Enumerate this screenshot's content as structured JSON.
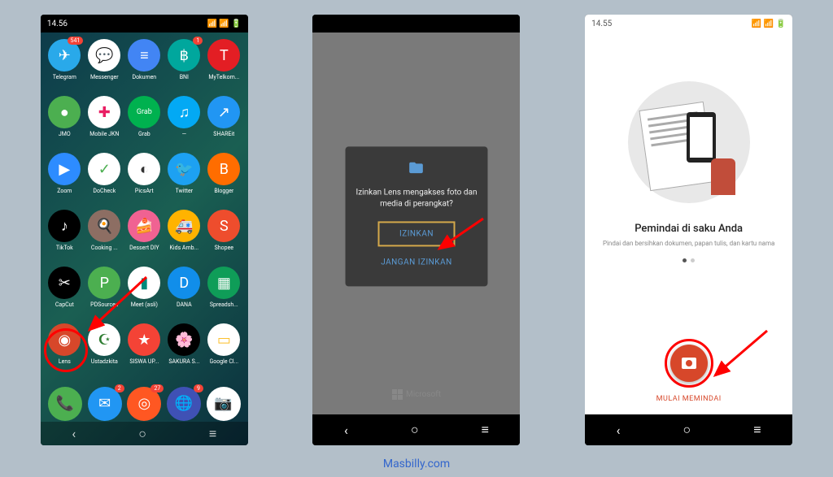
{
  "statusbar": {
    "time1": "14.56",
    "time3": "14.55",
    "icons_text": "⚙"
  },
  "phone1": {
    "apps": [
      {
        "label": "Telegram",
        "bg": "#29a9ea",
        "glyph": "✈",
        "badge": "541"
      },
      {
        "label": "Messenger",
        "bg": "#fff",
        "glyph": "💬",
        "fg": "#1e88e5"
      },
      {
        "label": "Dokumen",
        "bg": "#4285f4",
        "glyph": "≡"
      },
      {
        "label": "BNI",
        "bg": "#00a79d",
        "glyph": "฿",
        "badge": "1"
      },
      {
        "label": "MyTelkom...",
        "bg": "#e31e24",
        "glyph": "T"
      },
      {
        "label": "JMO",
        "bg": "#4caf50",
        "glyph": "●"
      },
      {
        "label": "Mobile JKN",
        "bg": "#fff",
        "glyph": "✚",
        "fg": "#e91e63"
      },
      {
        "label": "Grab",
        "bg": "#00b14f",
        "glyph": "Grab"
      },
      {
        "label": "—",
        "bg": "#03a9f4",
        "glyph": "♫"
      },
      {
        "label": "SHAREit",
        "bg": "#2196f3",
        "glyph": "↗"
      },
      {
        "label": "Zoom",
        "bg": "#2d8cff",
        "glyph": "▶"
      },
      {
        "label": "DoCheck",
        "bg": "#fff",
        "glyph": "✓",
        "fg": "#4caf50"
      },
      {
        "label": "PicsArt",
        "bg": "#fff",
        "glyph": "◐",
        "fg": "#333"
      },
      {
        "label": "Twitter",
        "bg": "#1da1f2",
        "glyph": "🐦"
      },
      {
        "label": "Blogger",
        "bg": "#ff6d00",
        "glyph": "B"
      },
      {
        "label": "TikTok",
        "bg": "#000",
        "glyph": "♪"
      },
      {
        "label": "Cooking ...",
        "bg": "#8d6e63",
        "glyph": "🍳"
      },
      {
        "label": "Dessert DIY",
        "bg": "#f06292",
        "glyph": "🍰"
      },
      {
        "label": "Kids Amb...",
        "bg": "#ffb300",
        "glyph": "🚑"
      },
      {
        "label": "Shopee",
        "bg": "#ee4d2d",
        "glyph": "S"
      },
      {
        "label": "CapCut",
        "bg": "#000",
        "glyph": "✂"
      },
      {
        "label": "PDSources",
        "bg": "#4caf50",
        "glyph": "P"
      },
      {
        "label": "Meet (asli)",
        "bg": "#fff",
        "glyph": "▮",
        "fg": "#00897b"
      },
      {
        "label": "DANA",
        "bg": "#118eea",
        "glyph": "D"
      },
      {
        "label": "Spreadsh...",
        "bg": "#0f9d58",
        "glyph": "▦"
      },
      {
        "label": "Lens",
        "bg": "#d7472a",
        "glyph": "◉"
      },
      {
        "label": "Ustadzkita",
        "bg": "#fff",
        "glyph": "☪",
        "fg": "#2e7d32"
      },
      {
        "label": "SISWA UP...",
        "bg": "#f44336",
        "glyph": "★"
      },
      {
        "label": "SAKURA S...",
        "bg": "#000",
        "glyph": "🌸"
      },
      {
        "label": "Google Cl...",
        "bg": "#fff",
        "glyph": "▭",
        "fg": "#fbc02d"
      }
    ],
    "dock": [
      {
        "bg": "#4caf50",
        "glyph": "📞"
      },
      {
        "bg": "#2196f3",
        "glyph": "✉",
        "badge": "2"
      },
      {
        "bg": "#ff5722",
        "glyph": "◎",
        "badge": "27"
      },
      {
        "bg": "#3f51b5",
        "glyph": "🌐",
        "badge": "9"
      },
      {
        "bg": "#fff",
        "glyph": "📷",
        "fg": "#555"
      }
    ]
  },
  "phone2": {
    "dialog_text": "Izinkan Lens mengakses foto dan media di perangkat?",
    "allow": "IZINKAN",
    "deny": "JANGAN IZINKAN",
    "brand": "Microsoft"
  },
  "phone3": {
    "title": "Pemindai di saku Anda",
    "subtitle": "Pindai dan bersihkan dokumen, papan tulis, dan kartu nama",
    "cta": "MULAI MEMINDAI"
  },
  "caption": "Masbilly.com"
}
